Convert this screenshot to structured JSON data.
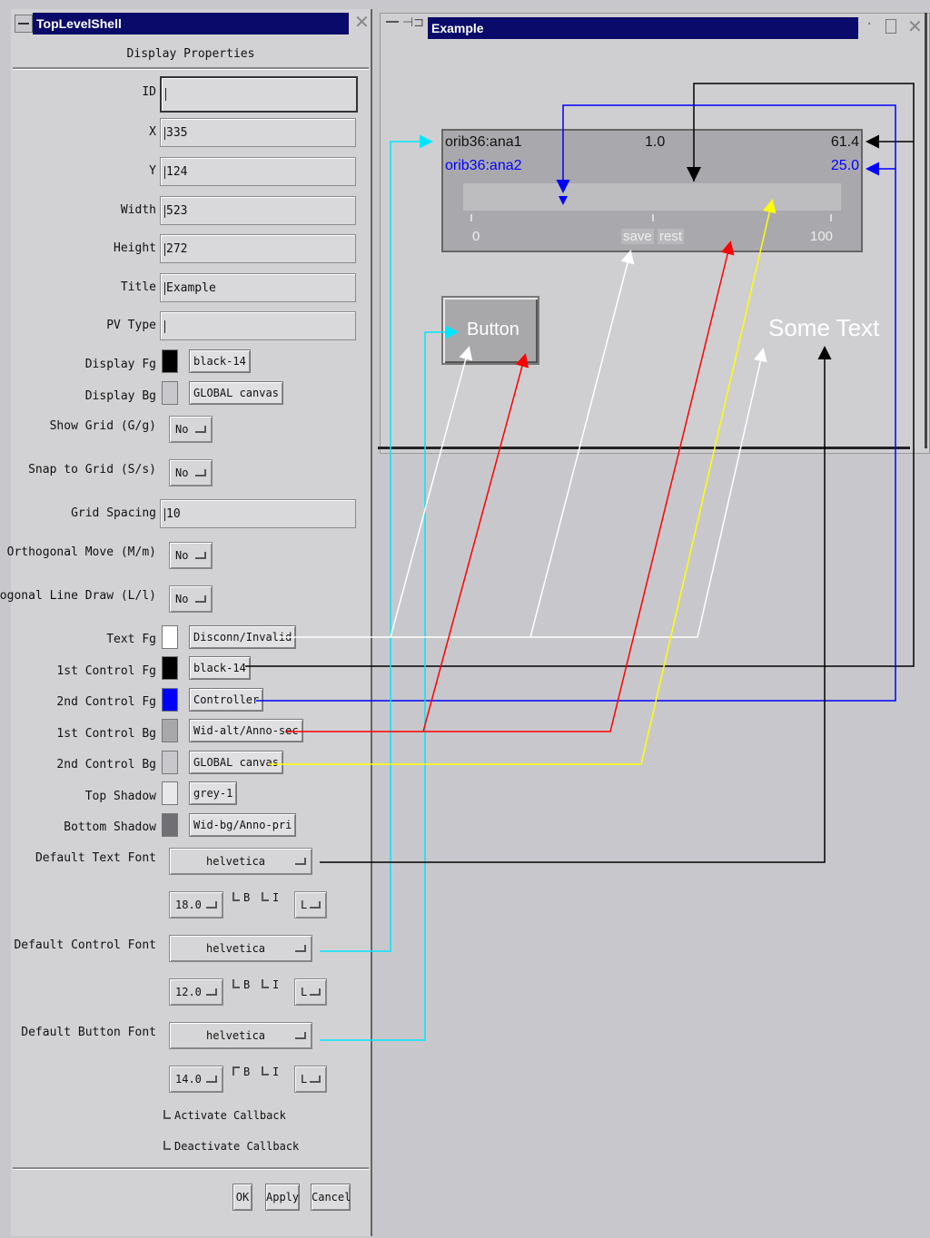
{
  "shell": {
    "title": "TopLevelShell",
    "section_title": "Display Properties",
    "fields": {
      "id": {
        "label": "ID",
        "value": ""
      },
      "x": {
        "label": "X",
        "value": "335"
      },
      "y": {
        "label": "Y",
        "value": "124"
      },
      "width": {
        "label": "Width",
        "value": "523"
      },
      "height": {
        "label": "Height",
        "value": "272"
      },
      "title": {
        "label": "Title",
        "value": "Example"
      },
      "pv_type": {
        "label": "PV Type",
        "value": ""
      },
      "grid_spacing": {
        "label": "Grid Spacing",
        "value": "10"
      }
    },
    "display_fg": {
      "label": "Display Fg",
      "color": "#000000",
      "value": "black-14"
    },
    "display_bg": {
      "label": "Display Bg",
      "color": "#c8c8cc",
      "value": "GLOBAL canvas"
    },
    "show_grid": {
      "label": "Show Grid (G/g)",
      "value": "No"
    },
    "snap_grid": {
      "label": "Snap to Grid (S/s)",
      "value": "No"
    },
    "ortho_move": {
      "label": "Orthogonal Move (M/m)",
      "value": "No"
    },
    "ortho_line": {
      "label": "Orthogonal Line Draw (L/l)",
      "value": "No"
    },
    "colors": [
      {
        "label": "Text Fg",
        "color": "#ffffff",
        "value": "Disconn/Invalid"
      },
      {
        "label": "1st Control Fg",
        "color": "#000000",
        "value": "black-14"
      },
      {
        "label": "2nd Control Fg",
        "color": "#0000ff",
        "value": "Controller"
      },
      {
        "label": "1st Control Bg",
        "color": "#a8a8ab",
        "value": "Wid-alt/Anno-sec"
      },
      {
        "label": "2nd Control Bg",
        "color": "#c8c8cc",
        "value": "GLOBAL canvas"
      },
      {
        "label": "Top Shadow",
        "color": "#e8e8ea",
        "value": "grey-1"
      },
      {
        "label": "Bottom Shadow",
        "color": "#707074",
        "value": "Wid-bg/Anno-pri"
      }
    ],
    "fonts": [
      {
        "label": "Default Text Font",
        "family": "helvetica",
        "size": "18.0",
        "bold": "B",
        "italic": "I",
        "align": "L"
      },
      {
        "label": "Default Control Font",
        "family": "helvetica",
        "size": "12.0",
        "bold": "B",
        "italic": "I",
        "align": "L"
      },
      {
        "label": "Default Button Font",
        "family": "helvetica",
        "size": "14.0",
        "bold": "B",
        "italic": "I",
        "align": "L"
      }
    ],
    "activate_cb": "Activate Callback",
    "deactivate_cb": "Deactivate Callback",
    "buttons": {
      "ok": "OK",
      "apply": "Apply",
      "cancel": "Cancel"
    }
  },
  "example": {
    "title": "Example",
    "meter": {
      "pv1": "orib36:ana1",
      "pv2": "orib36:ana2",
      "center_value": "1.0",
      "right_value1": "61.4",
      "right_value2": "25.0",
      "min_label": "0",
      "max_label": "100",
      "save_label": "save",
      "rest_label": "rest",
      "pv2_color": "#0000ff"
    },
    "button_label": "Button",
    "some_text": "Some Text"
  }
}
